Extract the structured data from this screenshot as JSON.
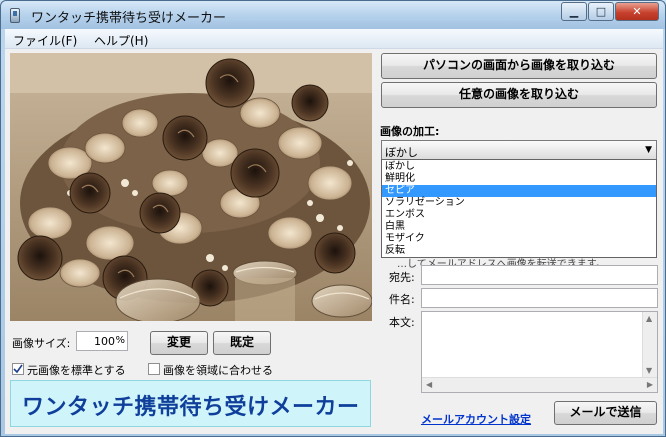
{
  "window": {
    "title": "ワンタッチ携帯待ち受けメーカー"
  },
  "menu": {
    "file": "ファイル(F)",
    "help": "ヘルプ(H)"
  },
  "image_panel": {
    "size_label": "画像サイズ:",
    "size_value": "100",
    "size_unit": "%",
    "change_button": "変更",
    "default_button": "既定",
    "use_original_label": "元画像を標準とする",
    "use_original_checked": true,
    "fit_to_area_label": "画像を領域に合わせる",
    "fit_to_area_checked": false,
    "banner_text": "ワンタッチ携帯待ち受けメーカー"
  },
  "right_panel": {
    "capture_screen_button": "パソコンの画面から画像を取り込む",
    "capture_any_button": "任意の画像を取り込む",
    "processing_label": "画像の加工:",
    "processing_selected": "ぼかし",
    "processing_options": [
      "ぼかし",
      "鮮明化",
      "セピア",
      "ソラリゼーション",
      "エンボス",
      "白黒",
      "モザイク",
      "反転"
    ],
    "highlighted_option_index": 2,
    "behind_text": "…してメールアドレスへ画像を転送できます。",
    "to_label": "宛先:",
    "subject_label": "件名:",
    "body_label": "本文:",
    "to_value": "",
    "subject_value": "",
    "body_value": "",
    "mail_account_link": "メールアカウント設定",
    "send_button": "メールで送信"
  },
  "icons": {
    "app": "phone-icon",
    "minimize": "minimize-icon",
    "maximize": "maximize-icon",
    "close": "close-icon",
    "dropdown": "chevron-down-icon"
  }
}
